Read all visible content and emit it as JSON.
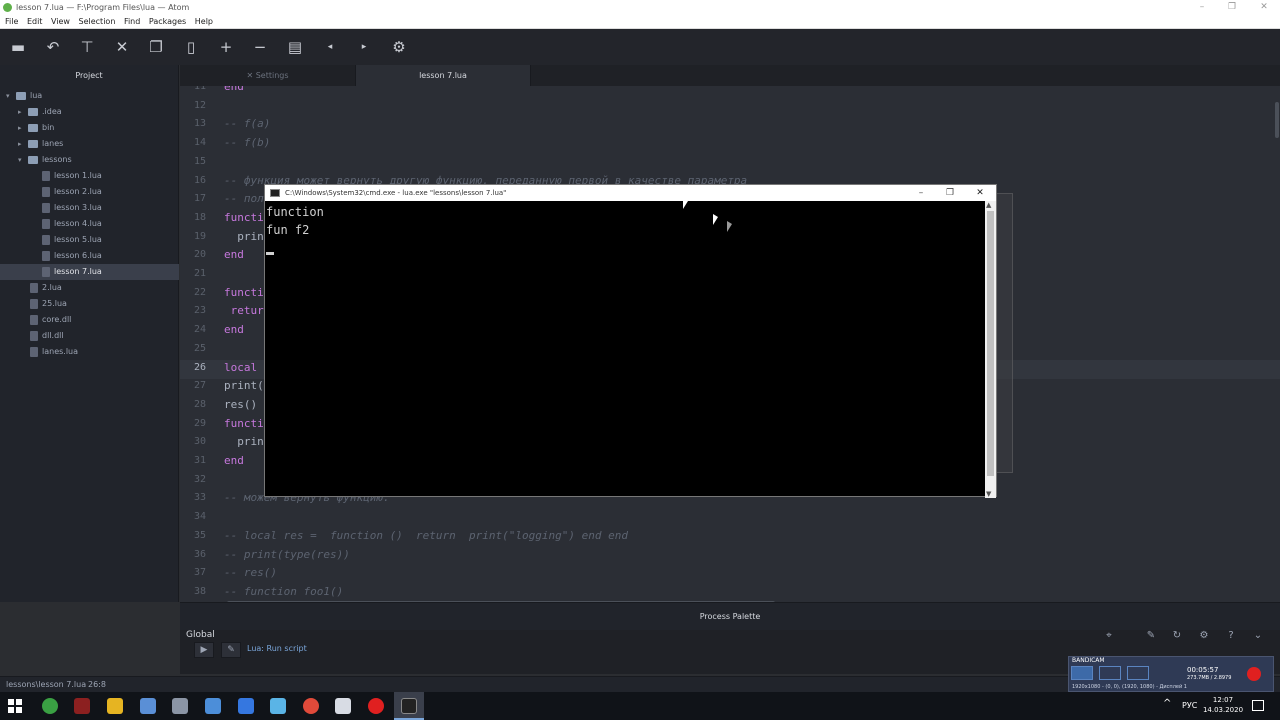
{
  "window": {
    "title": "lesson 7.lua — F:\\Program Files\\lua — Atom",
    "controls": [
      "–",
      "❐",
      "✕"
    ]
  },
  "menu": [
    "File",
    "Edit",
    "View",
    "Selection",
    "Find",
    "Packages",
    "Help"
  ],
  "toolbar_icons": [
    "folder-icon",
    "undo-icon",
    "format-icon",
    "tools-icon",
    "copy-icon",
    "bookmark-icon",
    "plus-icon",
    "minus-icon",
    "document-icon",
    "left-arrow-icon",
    "right-arrow-icon",
    "gear-icon"
  ],
  "sidebar": {
    "title": "Project",
    "items": [
      {
        "label": "lua",
        "type": "folder",
        "depth": 0,
        "open": true
      },
      {
        "label": ".idea",
        "type": "folder",
        "depth": 1,
        "open": false
      },
      {
        "label": "bin",
        "type": "folder",
        "depth": 1,
        "open": false
      },
      {
        "label": "lanes",
        "type": "folder",
        "depth": 1,
        "open": false
      },
      {
        "label": "lessons",
        "type": "folder",
        "depth": 1,
        "open": true
      },
      {
        "label": "lesson 1.lua",
        "type": "file",
        "depth": 2
      },
      {
        "label": "lesson 2.lua",
        "type": "file",
        "depth": 2
      },
      {
        "label": "lesson 3.lua",
        "type": "file",
        "depth": 2
      },
      {
        "label": "lesson 4.lua",
        "type": "file",
        "depth": 2
      },
      {
        "label": "lesson 5.lua",
        "type": "file",
        "depth": 2
      },
      {
        "label": "lesson 6.lua",
        "type": "file",
        "depth": 2
      },
      {
        "label": "lesson 7.lua",
        "type": "file",
        "depth": 2,
        "selected": true
      },
      {
        "label": "2.lua",
        "type": "file",
        "depth": 1
      },
      {
        "label": "25.lua",
        "type": "file",
        "depth": 1
      },
      {
        "label": "core.dll",
        "type": "file",
        "depth": 1
      },
      {
        "label": "dll.dll",
        "type": "file",
        "depth": 1
      },
      {
        "label": "lanes.lua",
        "type": "file",
        "depth": 1
      }
    ]
  },
  "tabs": [
    {
      "label": "Settings",
      "active": false
    },
    {
      "label": "lesson 7.lua",
      "active": true
    }
  ],
  "editor": {
    "lines": [
      {
        "n": "11",
        "text": "end",
        "kind": "kw"
      },
      {
        "n": "12",
        "text": "",
        "kind": "hl"
      },
      {
        "n": "13",
        "text": "-- f(a)",
        "kind": "cm"
      },
      {
        "n": "14",
        "text": "-- f(b)",
        "kind": "cm"
      },
      {
        "n": "15",
        "text": "",
        "kind": "hl"
      },
      {
        "n": "16",
        "text": "-- функция может вернуть другую функцию, переданную первой в качестве параметра",
        "kind": "cm"
      },
      {
        "n": "17",
        "text": "-- пол",
        "kind": "cm"
      },
      {
        "n": "18",
        "text": "functi",
        "kind": "kw"
      },
      {
        "n": "19",
        "text": "  prin",
        "kind": "hl"
      },
      {
        "n": "20",
        "text": "end",
        "kind": "kw"
      },
      {
        "n": "21",
        "text": "",
        "kind": "hl"
      },
      {
        "n": "22",
        "text": "functio",
        "kind": "kw"
      },
      {
        "n": "23",
        "text": " return",
        "kind": "kw"
      },
      {
        "n": "24",
        "text": "end",
        "kind": "kw"
      },
      {
        "n": "25",
        "text": "",
        "kind": "hl"
      },
      {
        "n": "26",
        "text": "local re",
        "kind": "kw"
      },
      {
        "n": "27",
        "text": "print(ty",
        "kind": "hl"
      },
      {
        "n": "28",
        "text": "res()",
        "kind": "hl"
      },
      {
        "n": "29",
        "text": "functio",
        "kind": "kw"
      },
      {
        "n": "30",
        "text": "  print(",
        "kind": "hl"
      },
      {
        "n": "31",
        "text": "end",
        "kind": "kw"
      },
      {
        "n": "32",
        "text": "",
        "kind": "hl"
      },
      {
        "n": "33",
        "text": "-- можем вернуть функцию.",
        "kind": "cm"
      },
      {
        "n": "34",
        "text": "",
        "kind": "hl"
      },
      {
        "n": "35",
        "text": "-- local res =  function ()  return  print(\"logging\") end end",
        "kind": "cm"
      },
      {
        "n": "36",
        "text": "-- print(type(res))",
        "kind": "cm"
      },
      {
        "n": "37",
        "text": "-- res()",
        "kind": "cm"
      },
      {
        "n": "38",
        "text": "-- function foo1()",
        "kind": "cm"
      }
    ],
    "current_line": "26"
  },
  "cmd": {
    "title": "C:\\Windows\\System32\\cmd.exe - lua.exe  \"lessons\\lesson 7.lua\"",
    "output": [
      "function",
      "fun f2"
    ],
    "controls": [
      "–",
      "❐",
      "✕"
    ]
  },
  "palette": {
    "title": "Process Palette"
  },
  "bottom_panel": {
    "label": "Global",
    "task": "Lua: Run script"
  },
  "statusbar": {
    "path": "lessons\\lesson 7.lua",
    "position": "26:8"
  },
  "bandicam": {
    "brand": "BANDICAM",
    "time": "00:05:57",
    "size": "273.7MB / 2.8979",
    "footer": "1920x1080 - (0, 0), (1920, 1080) - Дисплей 1"
  },
  "taskbar": {
    "lang": "РУС",
    "time": "12:07",
    "date": "14.03.2020"
  }
}
